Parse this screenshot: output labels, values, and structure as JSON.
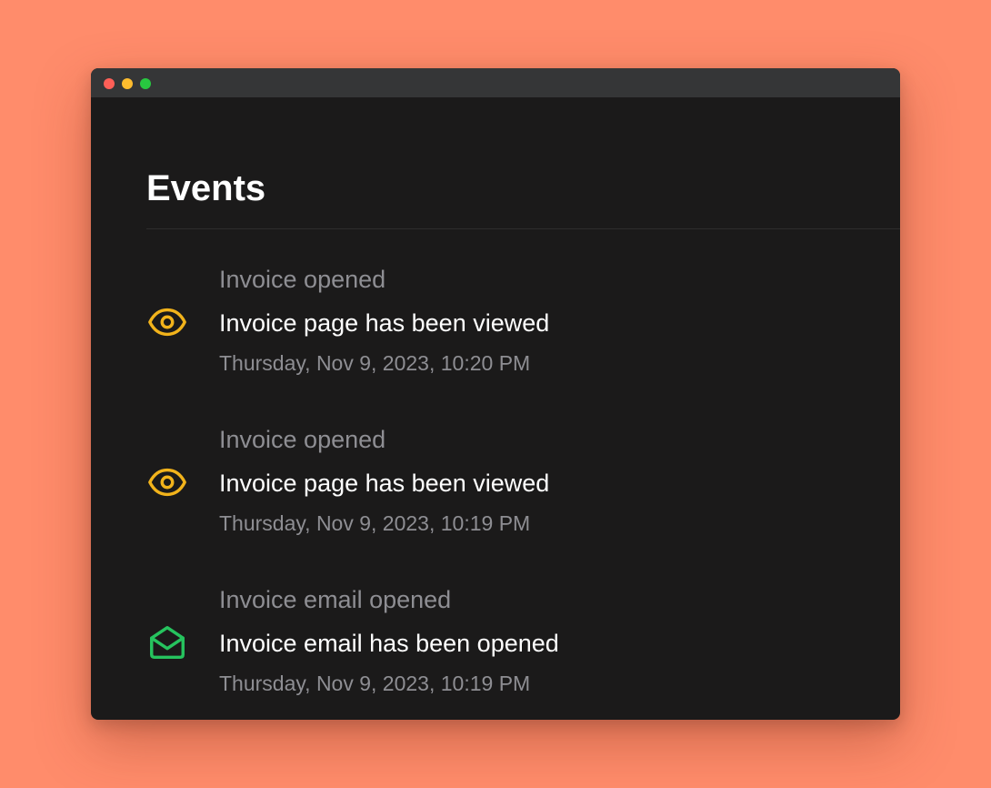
{
  "header": {
    "title": "Events"
  },
  "colors": {
    "background": "#FF8C6B",
    "window": "#1B1A1A",
    "eye_icon": "#F2B31B",
    "mail_icon": "#26C35E"
  },
  "events": [
    {
      "type": "Invoice opened",
      "description": "Invoice page has been viewed",
      "timestamp": "Thursday, Nov 9, 2023, 10:20 PM",
      "icon": "eye-icon"
    },
    {
      "type": "Invoice opened",
      "description": "Invoice page has been viewed",
      "timestamp": "Thursday, Nov 9, 2023, 10:19 PM",
      "icon": "eye-icon"
    },
    {
      "type": "Invoice email opened",
      "description": "Invoice email has been opened",
      "timestamp": "Thursday, Nov 9, 2023, 10:19 PM",
      "icon": "mail-open-icon"
    }
  ]
}
